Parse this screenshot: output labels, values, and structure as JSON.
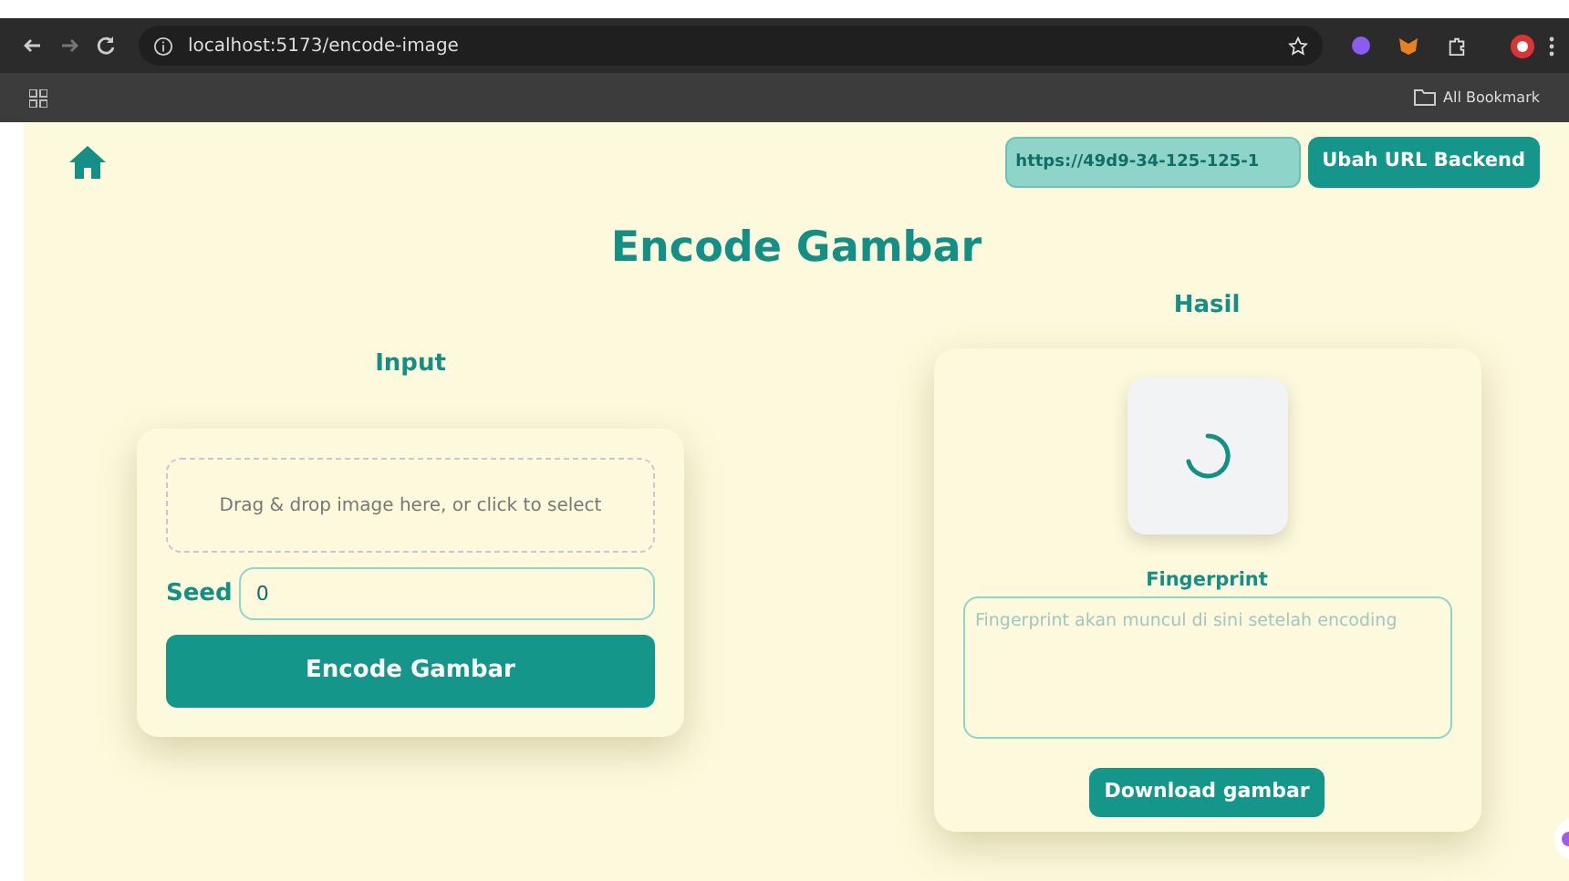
{
  "browser": {
    "url": "localhost:5173/encode-image",
    "bookmarks_label": "All Bookmark"
  },
  "header": {
    "backend_url": "https://49d9-34-125-125-1",
    "change_button": "Ubah URL Backend"
  },
  "title": "Encode Gambar",
  "input": {
    "heading": "Input",
    "dropzone": "Drag & drop image here, or click to select",
    "seed_label": "Seed",
    "seed_value": "0",
    "encode_button": "Encode Gambar"
  },
  "result": {
    "heading": "Hasil",
    "loading": true,
    "fingerprint_label": "Fingerprint",
    "fingerprint_placeholder": "Fingerprint akan muncul di sini setelah encoding",
    "download_button": "Download gambar"
  }
}
